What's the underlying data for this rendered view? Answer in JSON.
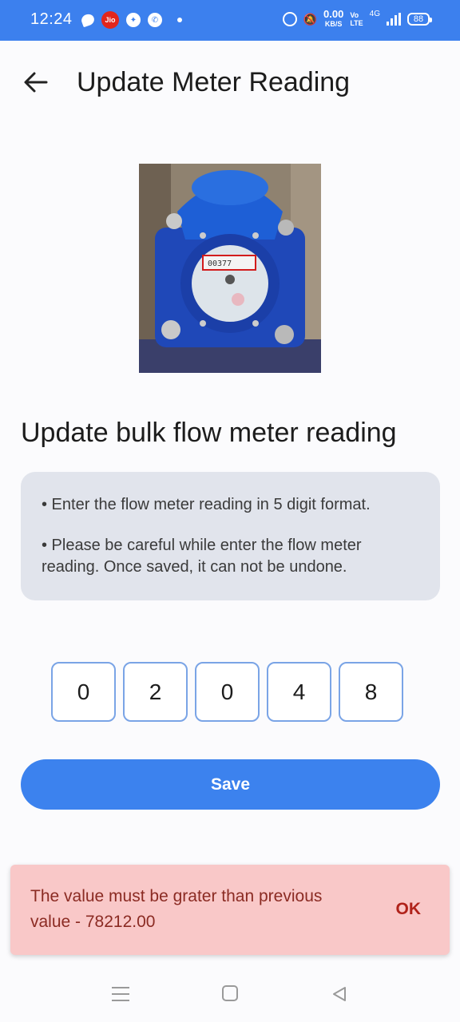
{
  "status_bar": {
    "time": "12:24",
    "jio_label": "Jio",
    "net_speed_value": "0.00",
    "net_speed_unit": "KB/S",
    "volte_top": "Vo",
    "volte_bottom": "LTE",
    "network_type": "4G",
    "battery": "88"
  },
  "header": {
    "title": "Update Meter Reading"
  },
  "meter_photo": {
    "reading_visible": "00377"
  },
  "section": {
    "title": "Update bulk flow meter reading"
  },
  "info": {
    "line1": "• Enter the flow meter reading in 5 digit format.",
    "line2": "• Please be careful while enter the flow meter reading. Once saved, it can not be undone."
  },
  "reading_digits": [
    "0",
    "2",
    "0",
    "4",
    "8"
  ],
  "save_button": {
    "label": "Save"
  },
  "snackbar": {
    "message": "The value must be grater than previous value - 78212.00",
    "action": "OK"
  },
  "colors": {
    "primary": "#3c80ee",
    "error_bg": "#f9c8c8",
    "error_text": "#8b2b23"
  }
}
